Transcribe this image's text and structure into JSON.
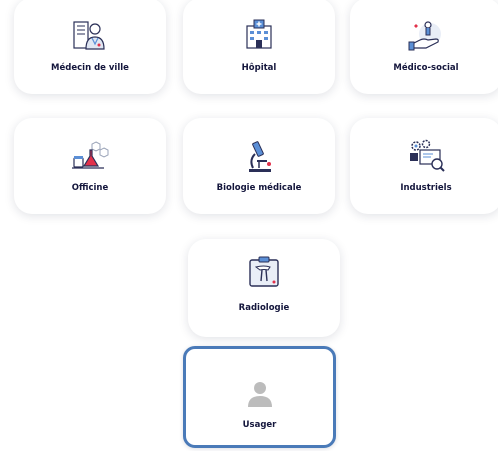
{
  "cards": [
    {
      "label": "Médecin de ville",
      "icon": "doctor-icon"
    },
    {
      "label": "Hôpital",
      "icon": "hospital-icon"
    },
    {
      "label": "Médico-social",
      "icon": "care-hand-icon"
    },
    {
      "label": "Officine",
      "icon": "pharmacy-icon"
    },
    {
      "label": "Biologie médicale",
      "icon": "microscope-icon"
    },
    {
      "label": "Industriels",
      "icon": "industry-icon"
    },
    {
      "label": "Radiologie",
      "icon": "xray-icon"
    },
    {
      "label": "Usager",
      "icon": "user-icon"
    }
  ],
  "colors": {
    "label": "#14163c",
    "icon_dark": "#2a2f57",
    "icon_red": "#e2314a",
    "icon_blue": "#5b8fd6",
    "selected_border": "#4a7ab8",
    "user_icon": "#bcbcbc"
  }
}
